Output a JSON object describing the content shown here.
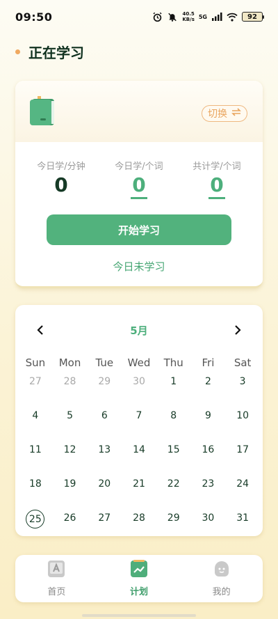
{
  "status_bar": {
    "time": "09:50",
    "net_speed_value": "40.5",
    "net_speed_unit": "KB/s",
    "network": "5G",
    "battery": "92"
  },
  "section": {
    "title": "正在学习"
  },
  "study_card": {
    "switch_label": "切换",
    "stats": [
      {
        "label": "今日学/分钟",
        "value": "0"
      },
      {
        "label": "今日学/个词",
        "value": "0"
      },
      {
        "label": "共计学/个词",
        "value": "0"
      }
    ],
    "start_button": "开始学习",
    "status_text": "今日未学习"
  },
  "calendar": {
    "month": "5月",
    "weekdays": [
      "Sun",
      "Mon",
      "Tue",
      "Wed",
      "Thu",
      "Fri",
      "Sat"
    ],
    "days": [
      [
        "27",
        "28",
        "29",
        "30",
        "1",
        "2",
        "3"
      ],
      [
        "4",
        "5",
        "6",
        "7",
        "8",
        "9",
        "10"
      ],
      [
        "11",
        "12",
        "13",
        "14",
        "15",
        "16",
        "17"
      ],
      [
        "18",
        "19",
        "20",
        "21",
        "22",
        "23",
        "24"
      ],
      [
        "25",
        "26",
        "27",
        "28",
        "29",
        "30",
        "31"
      ]
    ],
    "today": "25"
  },
  "tabbar": {
    "tabs": [
      {
        "label": "首页",
        "icon": "home-book-icon"
      },
      {
        "label": "计划",
        "icon": "plan-chart-icon"
      },
      {
        "label": "我的",
        "icon": "profile-face-icon"
      }
    ],
    "active": "计划"
  },
  "colors": {
    "accent_green": "#52b27d",
    "orange": "#e9a55e",
    "dark_text": "#163a26"
  }
}
